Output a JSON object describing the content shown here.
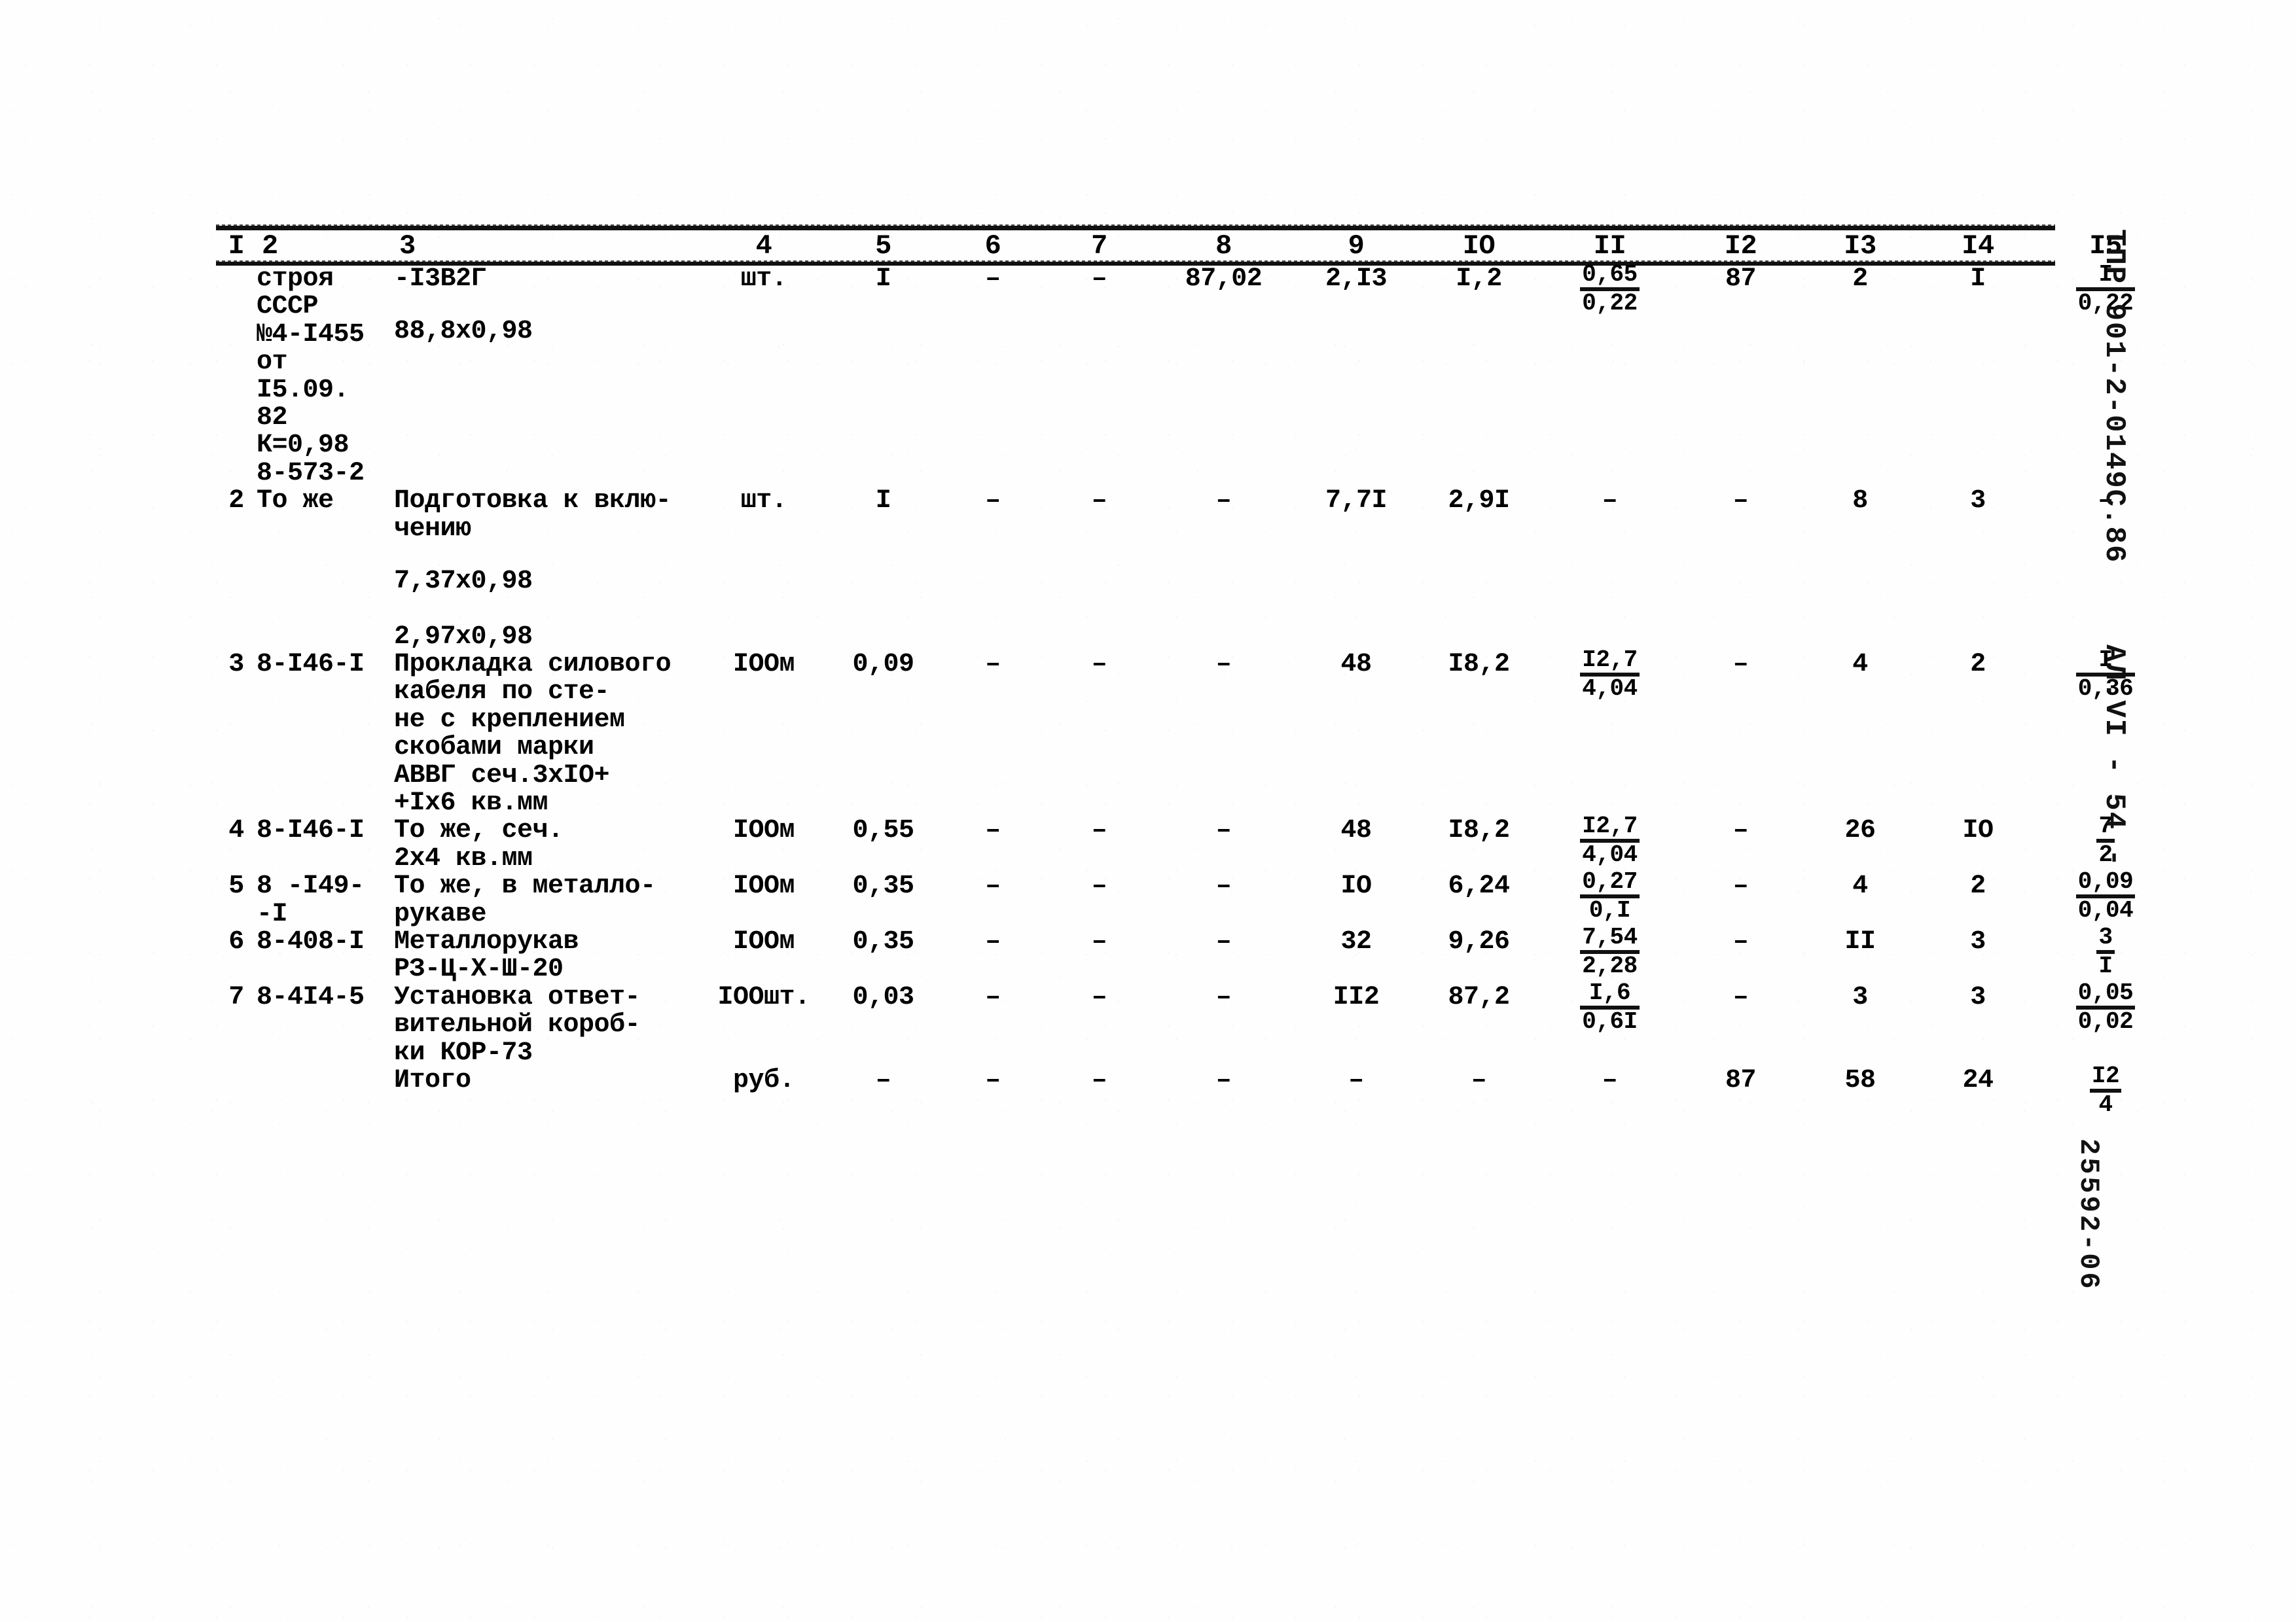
{
  "document": {
    "type": "Локальная смета / ведомость ресурсов (ТПР)",
    "margin_stamps": {
      "code": "ТПР 901-2-0149С.86",
      "sheet": "АЛ.VI  - 54 -",
      "archive": "25592-06"
    }
  },
  "table": {
    "column_numbers": [
      "I",
      "2",
      "3",
      "4",
      "5",
      "6",
      "7",
      "8",
      "9",
      "IO",
      "II",
      "I2",
      "I3",
      "I4",
      "I5"
    ],
    "rows": [
      {
        "num": "",
        "code": "строя\nСССР\n№4-I455\nот I5.09.\n82\nК=0,98\n8-573-2",
        "name": "-I3В2Г",
        "name_extra": "88,8х0,98",
        "unit": "шт.",
        "qty": "I",
        "c6": "–",
        "c7": "–",
        "c8": "87,02",
        "c9": "2,I3",
        "c10": "I,2",
        "c11": {
          "top": "0,65",
          "bot": "0,22"
        },
        "c12": "87",
        "c13": "2",
        "c14": "I",
        "c15": {
          "top": "I",
          "bot": "0,22"
        }
      },
      {
        "num": "2",
        "code": "То же",
        "name": "Подготовка к вклю-\nчению",
        "name_extra": "7,37х0,98\n\n2,97х0,98",
        "unit": "шт.",
        "qty": "I",
        "c6": "–",
        "c7": "–",
        "c8": "–",
        "c9": "7,7I",
        "c10": "2,9I",
        "c11": "–",
        "c12": "–",
        "c13": "8",
        "c14": "3",
        "c15": "–"
      },
      {
        "num": "3",
        "code": "8-I46-I",
        "name": "Прокладка силового\nкабеля по сте-\nне с креплением\nскобами марки\nАВВГ сеч.3хIО+\n+Iх6 кв.мм",
        "name_extra": "",
        "unit": "IOOм",
        "qty": "0,09",
        "c6": "–",
        "c7": "–",
        "c8": "–",
        "c9": "48",
        "c10": "I8,2",
        "c11": {
          "top": "I2,7",
          "bot": "4,04"
        },
        "c12": "–",
        "c13": "4",
        "c14": "2",
        "c15": {
          "top": "I",
          "bot": "0,36"
        }
      },
      {
        "num": "4",
        "code": "8-I46-I",
        "name": "То же, сеч.\n2х4 кв.мм",
        "name_extra": "",
        "unit": "IOOм",
        "qty": "0,55",
        "c6": "–",
        "c7": "–",
        "c8": "–",
        "c9": "48",
        "c10": "I8,2",
        "c11": {
          "top": "I2,7",
          "bot": "4,04"
        },
        "c12": "–",
        "c13": "26",
        "c14": "IO",
        "c15": {
          "top": "7",
          "bot": "2"
        }
      },
      {
        "num": "5",
        "code": "8  -I49-\n-I",
        "name": "То же, в металло-\nрукаве",
        "name_extra": "",
        "unit": "IOOм",
        "qty": "0,35",
        "c6": "–",
        "c7": "–",
        "c8": "–",
        "c9": "IO",
        "c10": "6,24",
        "c11": {
          "top": "0,27",
          "bot": "0,I"
        },
        "c12": "–",
        "c13": "4",
        "c14": "2",
        "c15": {
          "top": "0,09",
          "bot": "0,04"
        }
      },
      {
        "num": "6",
        "code": "8-408-I",
        "name": "Металлорукав\nРЗ-Ц-Х-Ш-20",
        "name_extra": "",
        "unit": "IOOм",
        "qty": "0,35",
        "c6": "–",
        "c7": "–",
        "c8": "–",
        "c9": "32",
        "c10": "9,26",
        "c11": {
          "top": "7,54",
          "bot": "2,28"
        },
        "c12": "–",
        "c13": "II",
        "c14": "3",
        "c15": {
          "top": "3",
          "bot": "I"
        }
      },
      {
        "num": "7",
        "code": "8-4I4-5",
        "name": "Установка ответ-\nвительной короб-\nки КОР-73",
        "name_extra": "",
        "unit": "IOOшт.",
        "qty": "0,03",
        "c6": "–",
        "c7": "–",
        "c8": "–",
        "c9": "II2",
        "c10": "87,2",
        "c11": {
          "top": "I,6",
          "bot": "0,6I"
        },
        "c12": "–",
        "c13": "3",
        "c14": "3",
        "c15": {
          "top": "0,05",
          "bot": "0,02"
        }
      },
      {
        "num": "",
        "code": "",
        "name": "Итого",
        "name_extra": "",
        "unit": "руб.",
        "qty": "–",
        "c6": "–",
        "c7": "–",
        "c8": "–",
        "c9": "–",
        "c10": "–",
        "c11": "–",
        "c12": "87",
        "c13": "58",
        "c14": "24",
        "c15": {
          "top": "I2",
          "bot": "4"
        }
      }
    ]
  }
}
